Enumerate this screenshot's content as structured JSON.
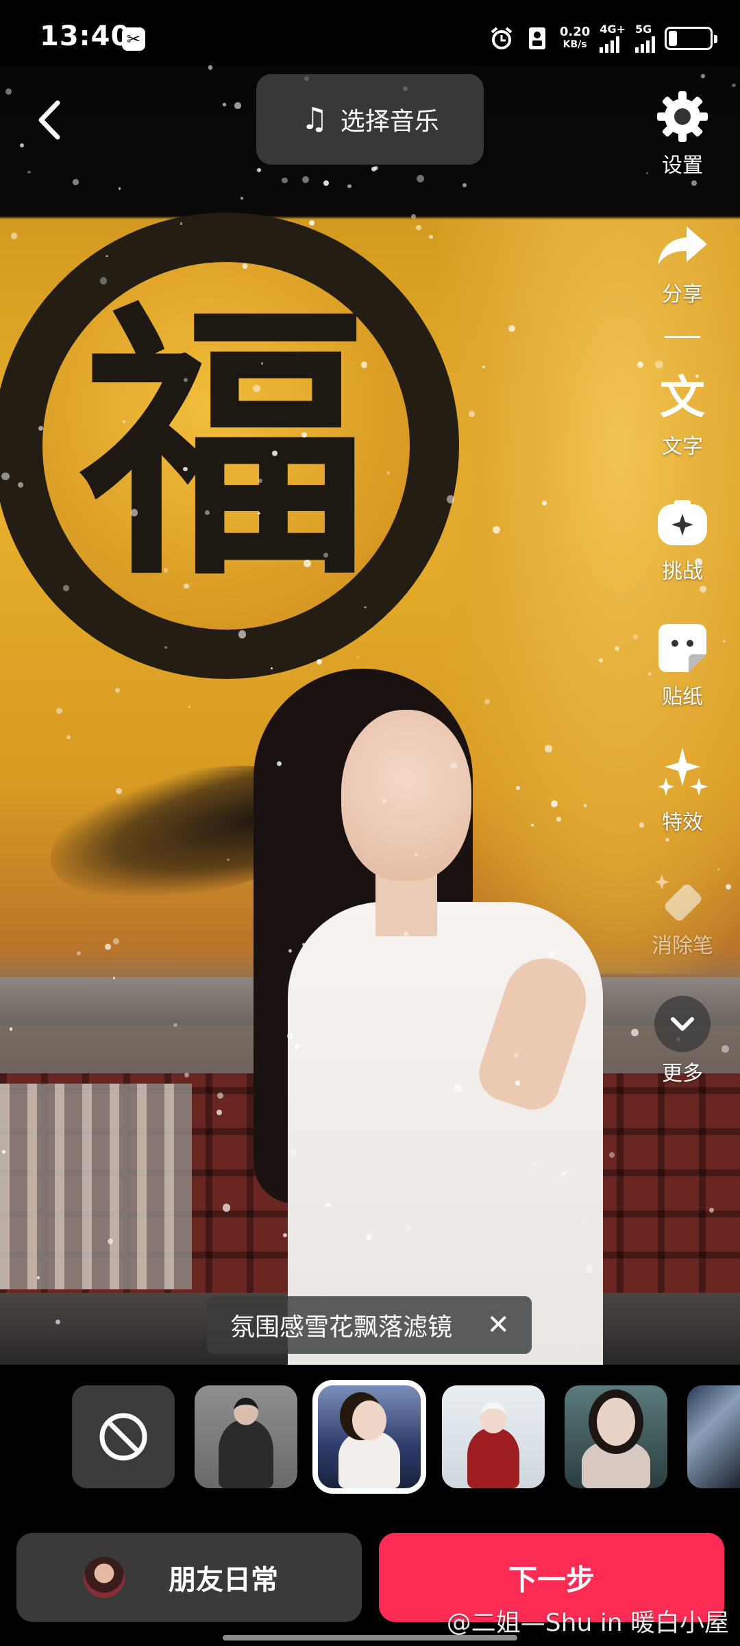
{
  "status_bar": {
    "time": "13:40",
    "app_icon": "capcut-icon",
    "net_speed": "0.20",
    "net_speed_unit": "KB/s",
    "network_1": "4G+",
    "network_2": "5G",
    "icons": [
      "alarm-icon",
      "sim-icon",
      "signal-icon",
      "battery-icon"
    ],
    "battery_level": 0.2
  },
  "top_bar": {
    "back_icon": "chevron-left-icon",
    "music_label": "选择音乐",
    "music_icon": "music-note-icon"
  },
  "tools": [
    {
      "id": "settings",
      "label": "设置",
      "icon": "gear-icon"
    },
    {
      "id": "share",
      "label": "分享",
      "icon": "share-arrow-icon"
    },
    {
      "id": "text",
      "label": "文字",
      "icon": "text-icon"
    },
    {
      "id": "challenge",
      "label": "挑战",
      "icon": "challenge-icon"
    },
    {
      "id": "sticker",
      "label": "贴纸",
      "icon": "sticker-icon"
    },
    {
      "id": "effects",
      "label": "特效",
      "icon": "sparkle-icon"
    },
    {
      "id": "eraser",
      "label": "消除笔",
      "icon": "eraser-icon"
    },
    {
      "id": "more",
      "label": "更多",
      "icon": "chevron-down-icon"
    }
  ],
  "filter_tag": {
    "label": "氛围感雪花飘落滤镜",
    "close_icon": "close-icon"
  },
  "filter_strip": {
    "none_icon": "prohibited-icon",
    "selected_index": 2
  },
  "bottom": {
    "friends_label": "朋友日常",
    "next_label": "下一步",
    "watermark": "@二姐—Shu in 暖白小屋"
  },
  "colors": {
    "accent": "#fe2c55",
    "wall": "#e8b12c"
  },
  "photo_text": "福"
}
